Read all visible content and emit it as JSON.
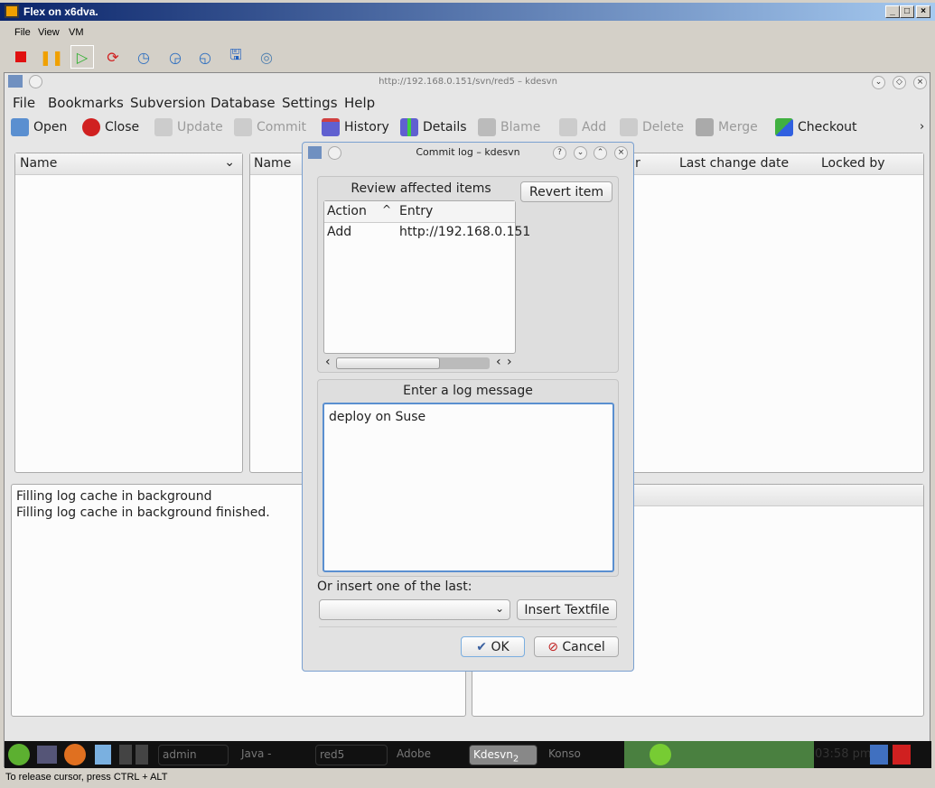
{
  "vm_window": {
    "title": "Flex on x6dva.",
    "controls": [
      "_",
      "□",
      "×"
    ],
    "menu": [
      "File",
      "View",
      "VM"
    ],
    "toolbar": [
      "stop-icon",
      "pause-icon",
      "play-icon",
      "reset-icon",
      "snapshot-icon",
      "revert-snapshot-icon",
      "snapshot-manager-icon",
      "settings-icon",
      "cd-settings-icon"
    ],
    "status": "To release cursor, press CTRL + ALT"
  },
  "kdesvn": {
    "title": "http://192.168.0.151/svn/red5 – kdesvn",
    "menu": [
      "File",
      "Bookmarks",
      "Subversion",
      "Database",
      "Settings",
      "Help"
    ],
    "toolbar": [
      {
        "label": "Open",
        "enabled": true
      },
      {
        "label": "Close",
        "enabled": true
      },
      {
        "label": "Update",
        "enabled": false
      },
      {
        "label": "Commit",
        "enabled": false
      },
      {
        "label": "History",
        "enabled": true
      },
      {
        "label": "Details",
        "enabled": true
      },
      {
        "label": "Blame",
        "enabled": false
      },
      {
        "label": "Add",
        "enabled": false
      },
      {
        "label": "Delete",
        "enabled": false
      },
      {
        "label": "Merge",
        "enabled": false
      },
      {
        "label": "Checkout",
        "enabled": true
      }
    ],
    "more": "›",
    "left_panel": {
      "header": "Name"
    },
    "main_panel": {
      "headers": [
        "Name",
        "r",
        "Last change date",
        "Locked by"
      ]
    },
    "log_lines": [
      "Filling log cache in background",
      "Filling log cache in background finished."
    ]
  },
  "dialog": {
    "title": "Commit log – kdesvn",
    "review_title": "Review affected items",
    "revert_button": "Revert item",
    "columns": [
      "Action",
      "Entry"
    ],
    "rows": [
      {
        "action": "Add",
        "entry": "http://192.168.0.151"
      }
    ],
    "log_title": "Enter a log message",
    "log_message": "deploy on Suse",
    "last_label": "Or insert one of the last:",
    "last_selected": "",
    "insert_button": "Insert Textfile",
    "ok": "OK",
    "cancel": "Cancel"
  },
  "taskbar": {
    "tasks": [
      "admin",
      "Java -",
      "red5",
      "Adobe",
      "Kdesvn",
      "Konso"
    ],
    "task_badge": "2",
    "clock": "03:58 pm"
  }
}
